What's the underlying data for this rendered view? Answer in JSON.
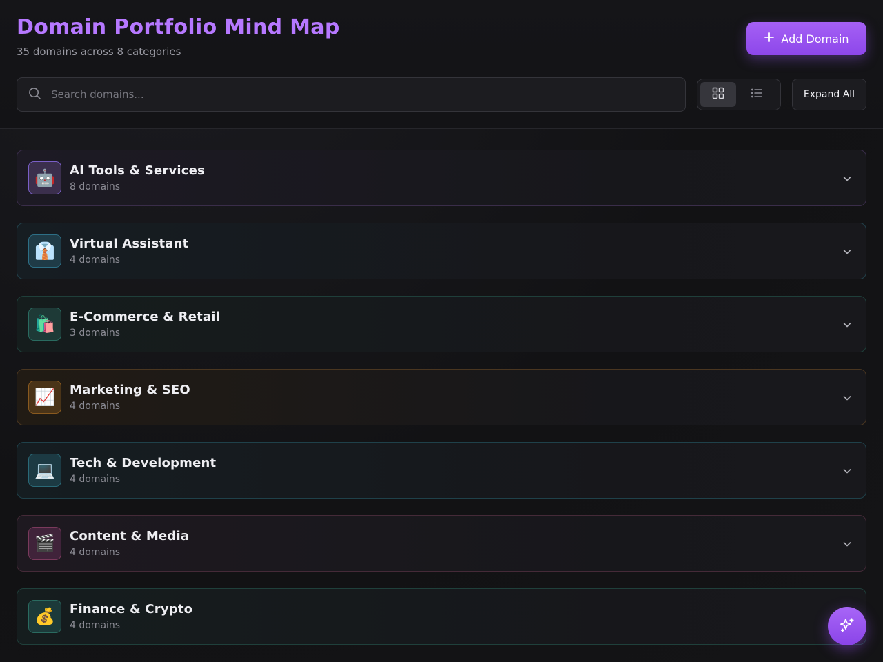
{
  "header": {
    "title": "Domain Portfolio Mind Map",
    "subtitle": "35 domains across 8 categories",
    "add_button_label": "Add Domain",
    "add_button_icon": "plus-icon"
  },
  "search": {
    "placeholder": "Search domains...",
    "value": "",
    "icon": "search-icon"
  },
  "view_toggle": {
    "options": [
      {
        "name": "grid-view",
        "icon": "grid-icon",
        "active": true
      },
      {
        "name": "list-view",
        "icon": "list-icon",
        "active": false
      }
    ]
  },
  "expand_button_label": "Expand All",
  "categories": [
    {
      "name": "AI Tools & Services",
      "count": "8 domains",
      "icon": "🤖",
      "accent": "#7a5fc7",
      "border": "#3a2d4a",
      "bg": "#1d1a24",
      "icon_bg": "#3b2f4d"
    },
    {
      "name": "Virtual Assistant",
      "count": "4 domains",
      "icon": "👔",
      "accent": "#2d6f86",
      "border": "#22404a",
      "bg": "#161d22",
      "icon_bg": "#1f3b47"
    },
    {
      "name": "E-Commerce & Retail",
      "count": "3 domains",
      "icon": "🛍️",
      "accent": "#2a6b60",
      "border": "#1f3f3a",
      "bg": "#151d1d",
      "icon_bg": "#1e3a37"
    },
    {
      "name": "Marketing & SEO",
      "count": "4 domains",
      "icon": "📈",
      "accent": "#8a5a1f",
      "border": "#4a3620",
      "bg": "#211b14",
      "icon_bg": "#4a3418"
    },
    {
      "name": "Tech & Development",
      "count": "4 domains",
      "icon": "💻",
      "accent": "#2a6a78",
      "border": "#1f414a",
      "bg": "#151d21",
      "icon_bg": "#1c3a43"
    },
    {
      "name": "Content & Media",
      "count": "4 domains",
      "icon": "🎬",
      "accent": "#7a3a5c",
      "border": "#452a38",
      "bg": "#1e1920",
      "icon_bg": "#40233a"
    },
    {
      "name": "Finance & Crypto",
      "count": "4 domains",
      "icon": "💰",
      "accent": "#2a6b60",
      "border": "#1f403b",
      "bg": "#151d1e",
      "icon_bg": "#1c3a3a"
    }
  ],
  "fab_icon": "sparkles-icon"
}
